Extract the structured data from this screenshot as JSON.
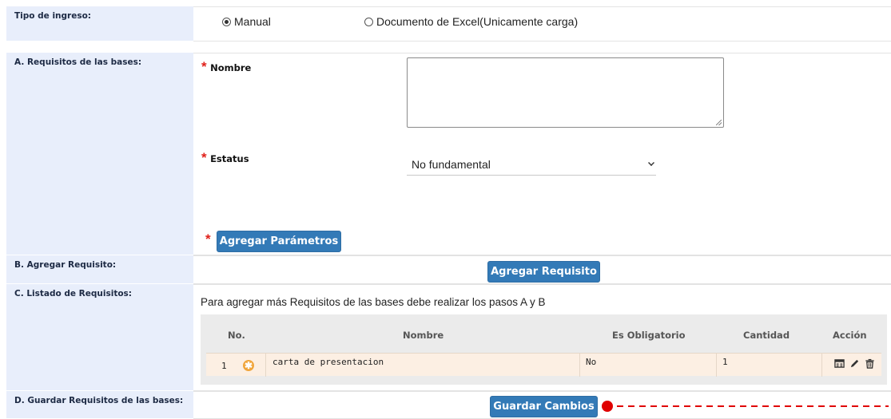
{
  "tipo_ingreso": {
    "label": "Tipo de ingreso:",
    "options": [
      {
        "label": "Manual",
        "checked": true
      },
      {
        "label": "Documento de Excel(Unicamente carga)",
        "checked": false
      }
    ]
  },
  "section_a": {
    "label": "A. Requisitos de las bases:",
    "nombre_label": "Nombre",
    "nombre_value": "",
    "estatus_label": "Estatus",
    "estatus_selected": "No fundamental",
    "required_mark": "*",
    "parametros_button": "Agregar Parámetros"
  },
  "section_b": {
    "label": "B. Agregar Requisito:",
    "button": "Agregar Requisito"
  },
  "section_c": {
    "label": "C. Listado de Requisitos:",
    "hint": "Para agregar más Requisitos de las bases debe realizar los pasos A y B",
    "columns": [
      "No.",
      "Nombre",
      "Es Obligatorio",
      "Cantidad",
      "Acción"
    ],
    "rows": [
      {
        "no": "1",
        "nombre": "carta de presentacion",
        "obligatorio": "No",
        "cantidad": "1"
      }
    ]
  },
  "section_d": {
    "label": "D. Guardar Requisitos de las bases:",
    "button": "Guardar Cambios"
  },
  "colors": {
    "accent": "#337ab7",
    "label_bg": "#e8eefb",
    "row_bg": "#fcefe3",
    "required": "#e0201a",
    "annotation": "#e00000"
  }
}
